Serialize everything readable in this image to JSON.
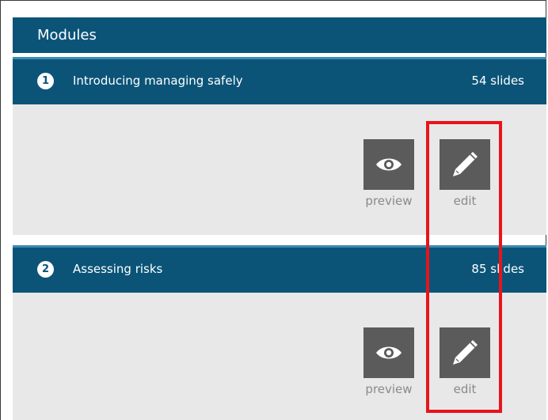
{
  "panel": {
    "title": "Modules"
  },
  "modules": [
    {
      "number": "1",
      "title": "Introducing managing safely",
      "slide_count": "54 slides",
      "preview_label": "preview",
      "edit_label": "edit"
    },
    {
      "number": "2",
      "title": "Assessing risks",
      "slide_count": "85 slides",
      "preview_label": "preview",
      "edit_label": "edit"
    }
  ],
  "icons": {
    "preview": "eye-icon",
    "edit": "pencil-icon"
  },
  "colors": {
    "header_blue": "#0b5478",
    "body_gray": "#e8e8e8",
    "tile_gray": "#5b5b5b",
    "label_gray": "#8a8a8a",
    "highlight_red": "#e8131b"
  }
}
